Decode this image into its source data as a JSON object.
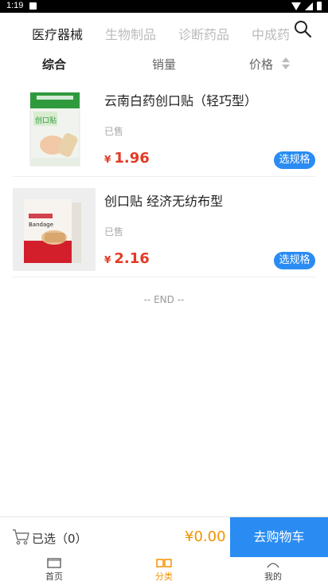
{
  "status_bar": {
    "time": "1:19"
  },
  "category_tabs": [
    {
      "label": "医疗器械",
      "active": true
    },
    {
      "label": "生物制品",
      "active": false
    },
    {
      "label": "诊断药品",
      "active": false
    },
    {
      "label": "中成药",
      "active": false
    }
  ],
  "sort_options": {
    "comprehensive": "综合",
    "sales": "销量",
    "price": "价格"
  },
  "products": [
    {
      "name": "云南白药创口贴（轻巧型）",
      "sold_label": "已售",
      "currency": "¥",
      "price": "1.96",
      "spec_button": "选规格",
      "image_icon": "bandage-box-image"
    },
    {
      "name": "创口贴 经济无纺布型",
      "sold_label": "已售",
      "currency": "¥",
      "price": "2.16",
      "spec_button": "选规格",
      "image_icon": "bandage-box-image"
    }
  ],
  "list_end": "-- END --",
  "cart": {
    "selected_label": "已选（0）",
    "total": "¥0.00",
    "checkout_label": "去购物车"
  },
  "bottom_nav": [
    {
      "label": "首页",
      "icon": "home-icon",
      "active": false
    },
    {
      "label": "分类",
      "icon": "category-icon",
      "active": true
    },
    {
      "label": "我的",
      "icon": "profile-icon",
      "active": false
    }
  ],
  "colors": {
    "accent_blue": "#2a8cf2",
    "price_red": "#e23b26",
    "orange": "#f29200"
  }
}
